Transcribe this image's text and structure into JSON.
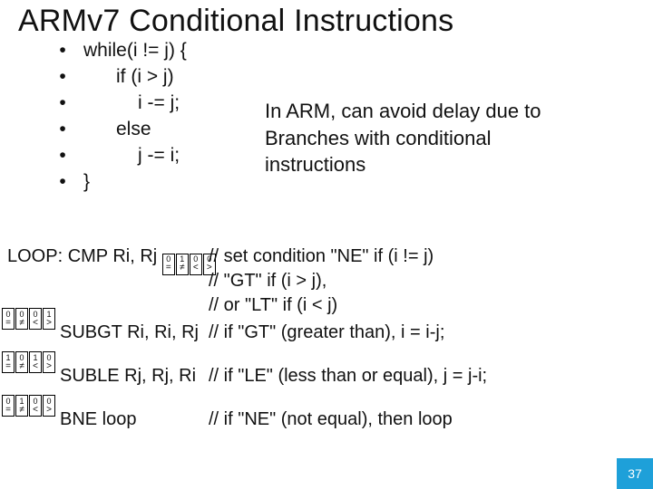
{
  "title": "ARMv7 Conditional Instructions",
  "code": {
    "b": "•",
    "l1": "while(i != j) {",
    "l2": "if (i > j)",
    "l3": "i -= j;",
    "l4": "else",
    "l5": "j -= i;",
    "l6": "}"
  },
  "note": {
    "l1": "In ARM, can avoid delay due to",
    "l2": "Branches with conditional",
    "l3": "instructions"
  },
  "flags": {
    "syms": [
      "=",
      "≠",
      "<",
      ">"
    ],
    "set_cmp": [
      "0",
      "1",
      "0",
      "0"
    ],
    "set_subgt": [
      "0",
      "0",
      "0",
      "1"
    ],
    "set_suble": [
      "1",
      "0",
      "1",
      "0"
    ],
    "set_bne": [
      "0",
      "1",
      "0",
      "0"
    ]
  },
  "asm": {
    "loop_label": "LOOP: CMP Ri, Rj",
    "cmp_c1": "// set condition \"NE\" if (i != j)",
    "cmp_c2": "// \"GT\" if (i > j),",
    "cmp_c3": "// or \"LT\" if (i < j)",
    "subgt": "SUBGT Ri, Ri, Rj",
    "subgt_c": "// if \"GT\" (greater than), i = i-j;",
    "suble": "SUBLE Rj, Rj, Ri",
    "suble_c": "// if \"LE\" (less than or equal), j = j-i;",
    "bne": "BNE loop",
    "bne_c": "// if \"NE\" (not equal), then loop"
  },
  "page": "37"
}
